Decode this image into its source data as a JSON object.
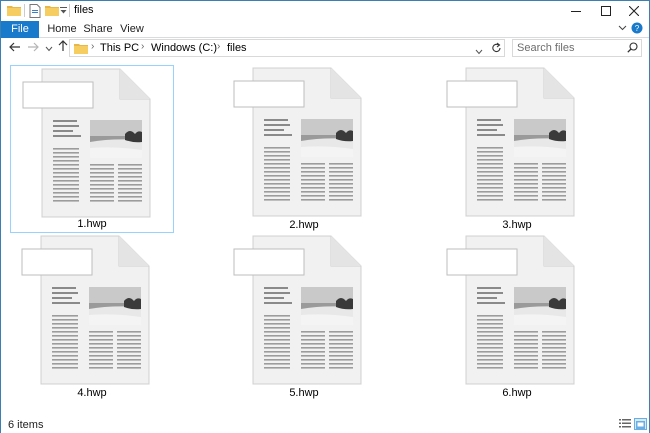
{
  "titlebar": {
    "title": "files",
    "controls": [
      "minimize",
      "maximize",
      "close"
    ]
  },
  "ribbon": {
    "tabs": [
      "File",
      "Home",
      "Share",
      "View"
    ],
    "active_tab": "File",
    "accent": "#1979ca"
  },
  "navigation": {
    "breadcrumb": [
      "This PC",
      "Windows (C:)",
      "files"
    ],
    "search_placeholder": "Search files"
  },
  "files": [
    {
      "name": "1.hwp",
      "selected": true
    },
    {
      "name": "2.hwp",
      "selected": false
    },
    {
      "name": "3.hwp",
      "selected": false
    },
    {
      "name": "4.hwp",
      "selected": false
    },
    {
      "name": "5.hwp",
      "selected": false
    },
    {
      "name": "6.hwp",
      "selected": false
    }
  ],
  "statusbar": {
    "item_count": "6 items"
  }
}
